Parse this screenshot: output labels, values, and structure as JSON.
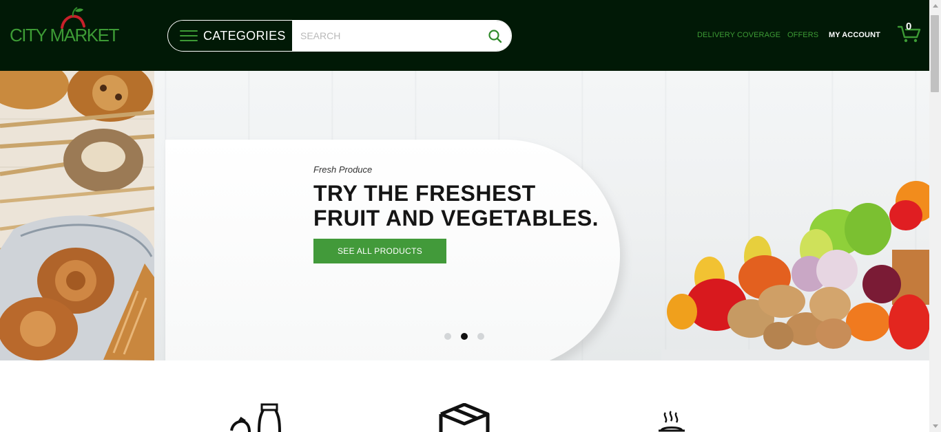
{
  "header": {
    "logo_text": "CITY MARKET",
    "categories_label": "CATEGORIES",
    "search_placeholder": "SEARCH",
    "nav": [
      {
        "label": "DELIVERY COVERAGE"
      },
      {
        "label": "OFFERS"
      },
      {
        "label": "MY ACCOUNT"
      }
    ],
    "cart_count": "0"
  },
  "hero": {
    "eyebrow": "Fresh Produce",
    "headline": "TRY THE FRESHEST\nFRUIT AND VEGETABLES.",
    "cta_label": "SEE ALL PRODUCTS",
    "slides_total": 3,
    "active_slide": 2
  },
  "features": {
    "icons": [
      "grocery-icon",
      "box-icon",
      "hot-food-icon"
    ]
  },
  "colors": {
    "header_bg": "#011906",
    "brand_green": "#3d9b35",
    "cta_green": "#429a3a",
    "apple_red": "#c8202a"
  }
}
